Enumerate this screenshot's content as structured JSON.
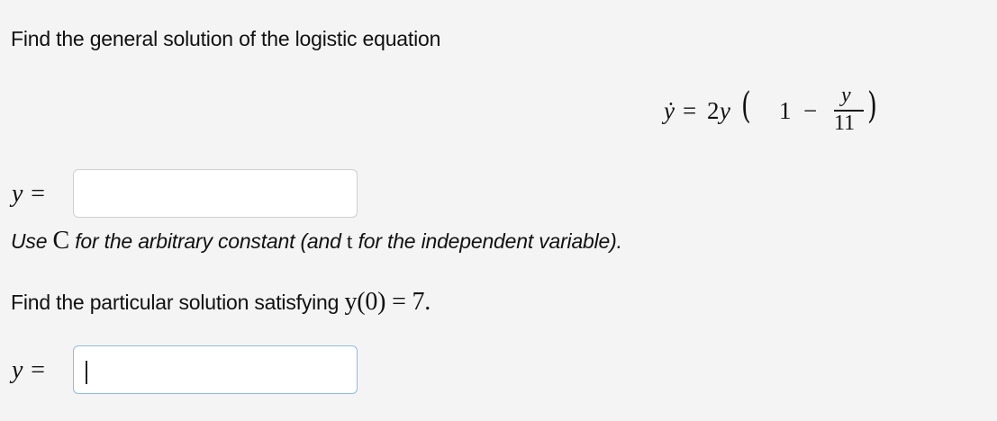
{
  "question1": {
    "text": "Find the general solution of the logistic equation"
  },
  "equation": {
    "lhs": "ẏ",
    "equals": "=",
    "coef": "2",
    "var": "y",
    "paren_open": "(",
    "one": "1",
    "minus": "−",
    "frac_num": "y",
    "frac_den": "11",
    "paren_close": ")"
  },
  "answer1": {
    "label": "y =",
    "value": ""
  },
  "note": {
    "prefix": "Use",
    "constant": "C",
    "middle": "for the arbitrary constant (and",
    "variable": "t",
    "suffix": "for the independent variable)."
  },
  "question2": {
    "text": "Find the particular solution satisfying",
    "condition": "y(0) = 7."
  },
  "answer2": {
    "label": "y =",
    "value": ""
  },
  "colors": {
    "background": "#f4f4f4",
    "input_border": "#cfcfcf",
    "focused_border": "#8fbbe6"
  }
}
